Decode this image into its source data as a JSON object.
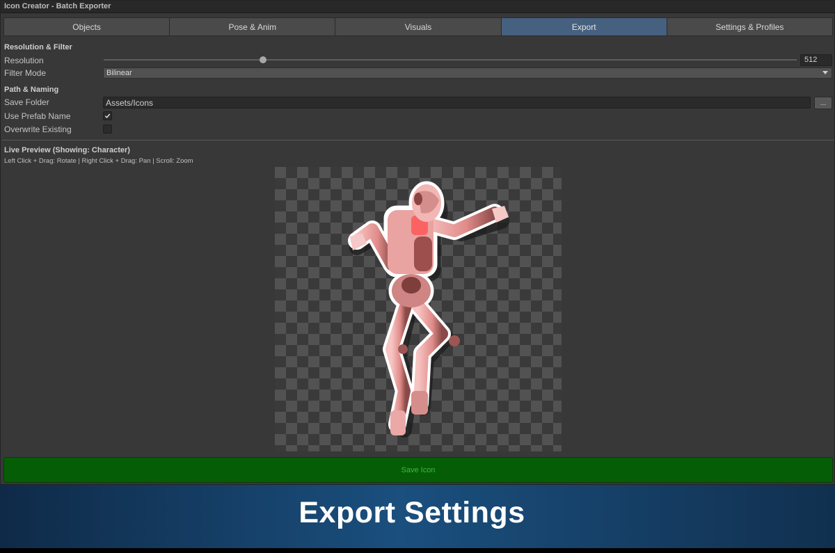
{
  "window": {
    "title": "Icon Creator - Batch Exporter"
  },
  "tabs": [
    {
      "label": "Objects",
      "active": false
    },
    {
      "label": "Pose & Anim",
      "active": false
    },
    {
      "label": "Visuals",
      "active": false
    },
    {
      "label": "Export",
      "active": true
    },
    {
      "label": "Settings & Profiles",
      "active": false
    }
  ],
  "resolution_filter": {
    "header": "Resolution & Filter",
    "resolution_label": "Resolution",
    "resolution_value": "512",
    "resolution_slider_fraction": 0.23,
    "filter_mode_label": "Filter Mode",
    "filter_mode_value": "Bilinear"
  },
  "path_naming": {
    "header": "Path & Naming",
    "save_folder_label": "Save Folder",
    "save_folder_value": "Assets/Icons",
    "browse_label": "...",
    "use_prefab_name_label": "Use Prefab Name",
    "use_prefab_name_checked": true,
    "overwrite_existing_label": "Overwrite Existing",
    "overwrite_existing_checked": false
  },
  "preview": {
    "title": "Live Preview (Showing: Character)",
    "hint": "Left Click + Drag: Rotate | Right Click + Drag: Pan | Scroll: Zoom"
  },
  "actions": {
    "save_icon_label": "Save Icon"
  },
  "banner": {
    "caption": "Export Settings"
  },
  "colors": {
    "active_tab": "#46607f",
    "save_button": "#055e05",
    "save_button_text": "#3dbb3d",
    "character_tint": "#e59a9a"
  }
}
